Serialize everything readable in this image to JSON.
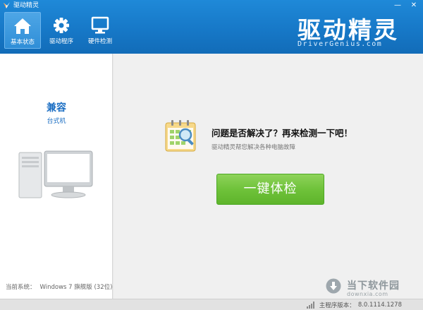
{
  "window": {
    "title": "驱动精灵",
    "minimize": "—",
    "close": "✕"
  },
  "nav": [
    {
      "label": "基本状态",
      "icon": "home-icon",
      "active": true
    },
    {
      "label": "驱动程序",
      "icon": "gear-icon",
      "active": false
    },
    {
      "label": "硬件检测",
      "icon": "monitor-icon",
      "active": false
    }
  ],
  "brand": {
    "name": "驱动精灵",
    "subtitle": "DriverGenius.com"
  },
  "left": {
    "pc_name": "兼容",
    "pc_type": "台式机",
    "system_label": "当前系统：",
    "system_value": "Windows 7 旗舰版 (32位)"
  },
  "main": {
    "headline": "问题是否解决了？再来检测一下吧！",
    "subline": "驱动精灵帮您解决各种电脑故障",
    "scan_button": "一键体检"
  },
  "watermark": {
    "text": "当下软件园",
    "url": "downxia.com"
  },
  "status": {
    "version_label": "主程序版本：",
    "version": "8.0.1114.1278"
  },
  "colors": {
    "header": "#1677c6",
    "accent": "#1b6ec3",
    "button": "#6fc23a"
  }
}
